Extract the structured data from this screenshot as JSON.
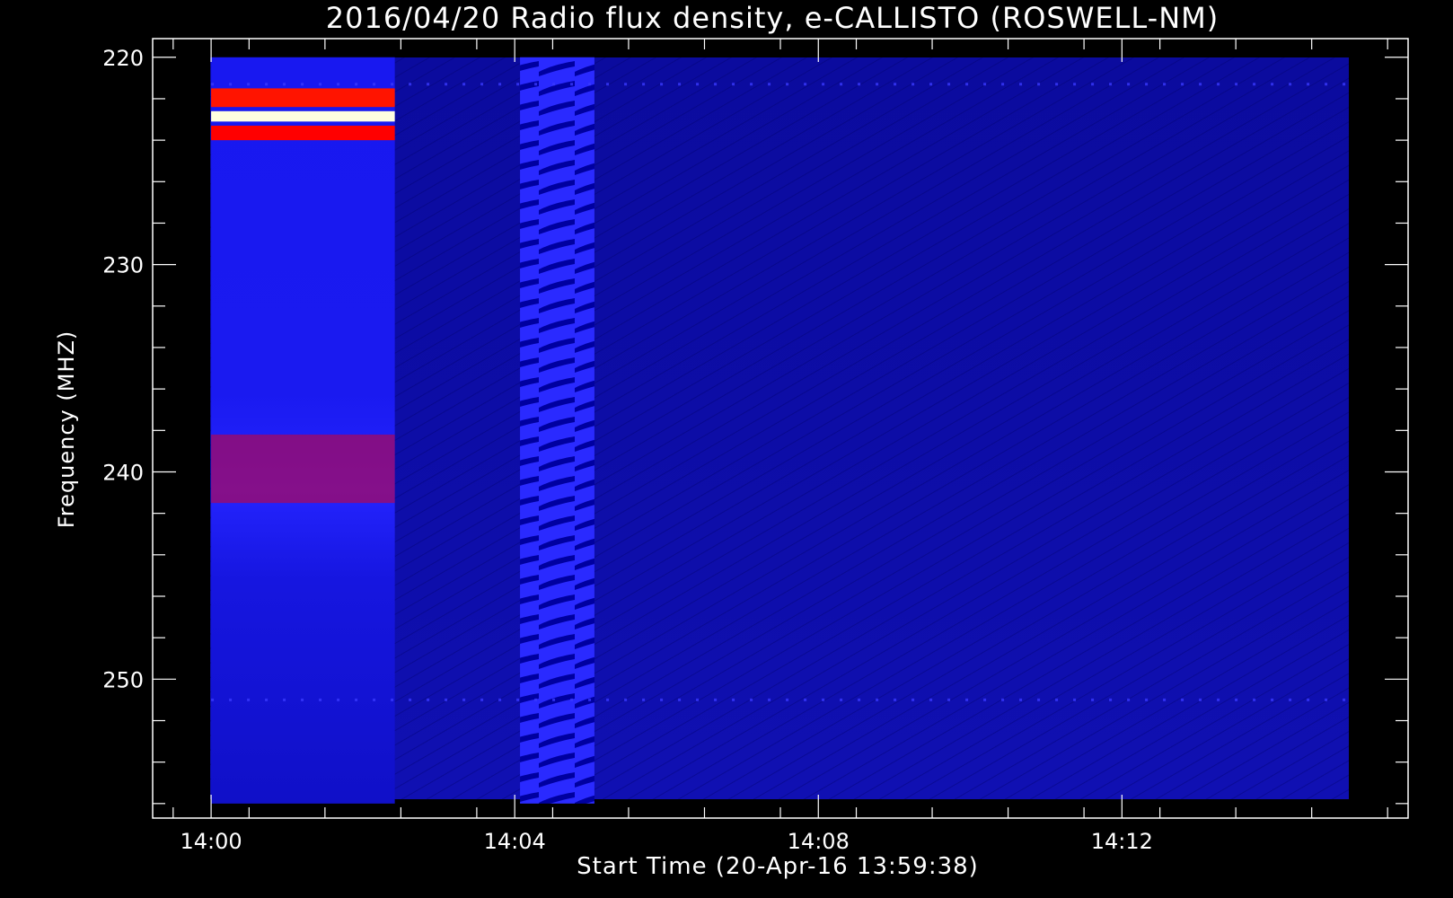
{
  "chart_data": {
    "type": "heatmap",
    "title": "2016/04/20  Radio flux density, e-CALLISTO (ROSWELL-NM)",
    "xlabel": "Start Time (20-Apr-16 13:59:38)",
    "ylabel": "Frequency (MHZ)",
    "x_ticks": [
      "14:00",
      "14:04",
      "14:08",
      "14:12"
    ],
    "x_tick_minutes": [
      0,
      4,
      8,
      12
    ],
    "xlim_minutes": [
      -0.77,
      15.77
    ],
    "data_x_range_minutes": [
      0,
      15
    ],
    "y_ticks": [
      220,
      230,
      240,
      250
    ],
    "ylim": [
      219.1,
      256.7
    ],
    "data_y_range": [
      220,
      256
    ],
    "y_reversed": true,
    "grid": false,
    "colormap": [
      "#000000",
      "#0000ff",
      "#ff0000",
      "#ffff00",
      "#ffffff"
    ],
    "features": [
      {
        "label": "narrowband interference",
        "x_minutes": [
          0,
          2.42
        ],
        "freq": [
          222.6,
          223.1
        ],
        "level": 0.97
      },
      {
        "label": "band",
        "x_minutes": [
          0,
          2.42
        ],
        "freq": [
          221.5,
          222.4
        ],
        "level": 0.52
      },
      {
        "label": "band",
        "x_minutes": [
          0,
          2.42
        ],
        "freq": [
          223.3,
          224.0
        ],
        "level": 0.5
      },
      {
        "label": "broad band",
        "x_minutes": [
          0,
          2.42
        ],
        "freq": [
          238.2,
          241.5
        ],
        "level": 0.46
      },
      {
        "label": "striated segment",
        "x_minutes": [
          4.07,
          5.05
        ],
        "freq": [
          220,
          256
        ],
        "level": 0.38
      }
    ]
  }
}
